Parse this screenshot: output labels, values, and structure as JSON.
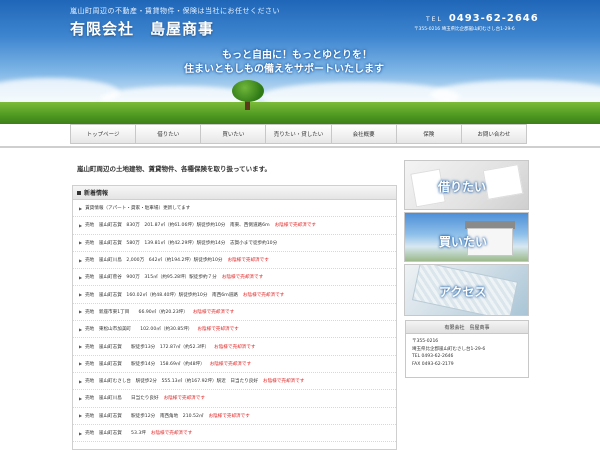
{
  "header": {
    "tagline": "嵐山町周辺の不動産・賃貸物件・保険は当社にお任せください",
    "company": "有限会社　島屋商事",
    "tel_label": "TEL",
    "tel_number": "0493-62-2646",
    "address": "〒355-0216 埼玉県比企郡嵐山町むさし台1-29-6",
    "catch_line1": "もっと自由に！もっとゆとりを！",
    "catch_line2": "住まいともしもの備えをサポートいたします"
  },
  "nav": {
    "items": [
      {
        "label": "トップページ"
      },
      {
        "label": "借りたい"
      },
      {
        "label": "買いたい"
      },
      {
        "label": "売りたい・貸したい"
      },
      {
        "label": "会社概要"
      },
      {
        "label": "保険"
      },
      {
        "label": "お問い合わせ"
      }
    ]
  },
  "main": {
    "intro": "嵐山町周辺の土地建物、賃貸物件、各種保険を取り扱っています。",
    "news_title": "新着情報",
    "news": [
      {
        "text": "賃貸情報（アパート・貸家・駐車場）更新してます",
        "status": ""
      },
      {
        "text": "売地　嵐山町志賀　830万　201.87㎡（約61.06坪）駅徒歩約10分　南東、西側道路6ｍ",
        "status": "お陰様で売却済です"
      },
      {
        "text": "売地　嵐山町志賀　580万　139.81㎡（約42.29坪）駅徒歩約14分　志賀小まで徒歩約10分",
        "status": ""
      },
      {
        "text": "売地　嵐山町川島　2,000万　642㎡（約194.2坪）駅徒歩約10分",
        "status": "お陰様で売却済です"
      },
      {
        "text": "売地　嵐山町菅谷　900万　315㎡（約95.28坪）駅徒歩約７分",
        "status": "お陰様で売却済です"
      },
      {
        "text": "売地　嵐山町志賀　160.02㎡（約48.40坪）駅徒歩約10分　南西6ｍ道路",
        "status": "お陰様で売却済です"
      },
      {
        "text": "売地　新座市東1丁目　　66.90㎡（約20.23坪）",
        "status": "お陰様で売却済です"
      },
      {
        "text": "売地　東松山市加美町　　102.00㎡（約30.85坪）",
        "status": "お陰様で売却済です"
      },
      {
        "text": "売地　嵐山町志賀　　駅徒歩13分　172.87㎡（約52.3坪）",
        "status": "お陰様で売却済です"
      },
      {
        "text": "売地　嵐山町志賀　　駅徒歩14分　158.69㎡（約48坪）",
        "status": "お陰様で売却済です"
      },
      {
        "text": "売地　嵐山町むさし台　駅徒歩2分　555.13㎡（約167.92坪）駅近　日当たり良好",
        "status": "お陰様で売却済です"
      },
      {
        "text": "売地　嵐山町川島　　日当たり良好",
        "status": "お陰様で売却済です"
      },
      {
        "text": "売地　嵐山町志賀　　駅徒歩12分　南西角地　210.52㎡",
        "status": "お陰様で売却済です"
      },
      {
        "text": "売地　嵐山町志賀　　53.3坪",
        "status": "お陰様で売却済です"
      }
    ]
  },
  "sidebar": {
    "banner_rent": "借りたい",
    "banner_buy": "買いたい",
    "banner_access": "アクセス",
    "info_title": "有限会社　島屋商事",
    "info_zip": "〒355-0216",
    "info_address": "埼玉県比企郡嵐山町むさし台1-29-6",
    "info_tel": "TEL 0493-62-2646",
    "info_fax": "FAX 0493-62-2179"
  },
  "colors": {
    "status_red": "#e02020",
    "sky_blue": "#3f86d0",
    "grass_green": "#4f9a22"
  }
}
